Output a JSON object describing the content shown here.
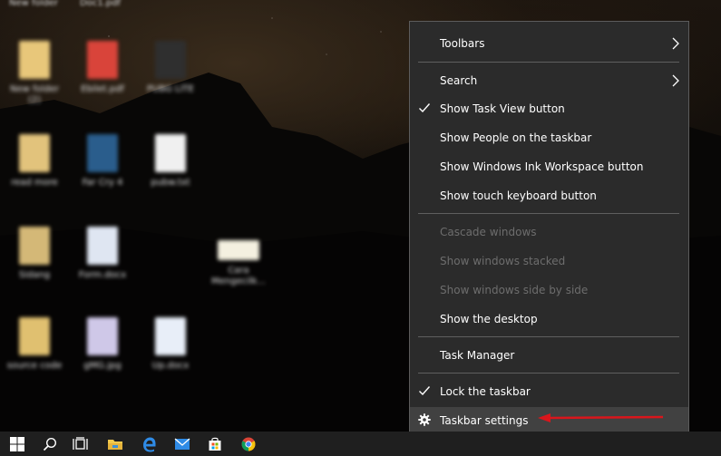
{
  "desktop": {
    "top_labels": [
      "New folder",
      "Doc1.pdf"
    ],
    "icons": [
      {
        "label_lines": [
          "New folder",
          "(2)"
        ],
        "icon": "folder-icon",
        "color": "#e8c77a"
      },
      {
        "label_lines": [
          "Ebilet.pdf"
        ],
        "icon": "pdf-icon",
        "color": "#d9443a"
      },
      {
        "label_lines": [
          "PUBG LITE"
        ],
        "icon": "pubg-icon",
        "color": "#2f2f2f"
      },
      {
        "label_lines": [
          "read more"
        ],
        "icon": "folder-icon",
        "color": "#e2c37c"
      },
      {
        "label_lines": [
          "Far Cry 4"
        ],
        "icon": "farcry-icon",
        "color": "#2a5d8c"
      },
      {
        "label_lines": [
          "pubw.txt"
        ],
        "icon": "text-file-icon",
        "color": "#f0f0f0"
      },
      {
        "label_lines": [
          "Sidang"
        ],
        "icon": "folder-icon",
        "color": "#d4b877"
      },
      {
        "label_lines": [
          "Form.docx"
        ],
        "icon": "word-doc-icon",
        "color": "#dfe6f2"
      },
      {
        "label_lines": [
          "Cara",
          "Mengecilk..."
        ],
        "icon": "image-file-icon",
        "color": "#f4f0e0"
      },
      {
        "label_lines": [
          "source code"
        ],
        "icon": "folder-icon",
        "color": "#e0c070"
      },
      {
        "label_lines": [
          "gMG.jpg"
        ],
        "icon": "image-file-icon",
        "color": "#cfc8e8"
      },
      {
        "label_lines": [
          "Up.docx"
        ],
        "icon": "word-doc-icon",
        "color": "#e8eef8"
      }
    ]
  },
  "menu": {
    "items": [
      {
        "label": "Toolbars",
        "checked": false,
        "submenu": true,
        "disabled": false
      },
      {
        "label": "Search",
        "checked": false,
        "submenu": true,
        "disabled": false
      },
      {
        "label": "Show Task View button",
        "checked": true,
        "submenu": false,
        "disabled": false
      },
      {
        "label": "Show People on the taskbar",
        "checked": false,
        "submenu": false,
        "disabled": false
      },
      {
        "label": "Show Windows Ink Workspace button",
        "checked": false,
        "submenu": false,
        "disabled": false
      },
      {
        "label": "Show touch keyboard button",
        "checked": false,
        "submenu": false,
        "disabled": false
      },
      {
        "label": "Cascade windows",
        "checked": false,
        "submenu": false,
        "disabled": true
      },
      {
        "label": "Show windows stacked",
        "checked": false,
        "submenu": false,
        "disabled": true
      },
      {
        "label": "Show windows side by side",
        "checked": false,
        "submenu": false,
        "disabled": true
      },
      {
        "label": "Show the desktop",
        "checked": false,
        "submenu": false,
        "disabled": false
      },
      {
        "label": "Task Manager",
        "checked": false,
        "submenu": false,
        "disabled": false
      },
      {
        "label": "Lock the taskbar",
        "checked": true,
        "submenu": false,
        "disabled": false
      },
      {
        "label": "Taskbar settings",
        "checked": false,
        "submenu": false,
        "disabled": false,
        "icon": "gear-icon",
        "highlighted": true
      }
    ],
    "colors": {
      "background": "#2b2b2b",
      "highlight": "#414141",
      "disabled_text": "#6d6d6d",
      "annotation_arrow": "#d9161c"
    }
  },
  "taskbar": {
    "buttons": [
      "windows-start-icon",
      "search-icon",
      "task-view-icon",
      "file-explorer-icon",
      "edge-browser-icon",
      "mail-icon",
      "store-icon",
      "chrome-icon"
    ]
  }
}
